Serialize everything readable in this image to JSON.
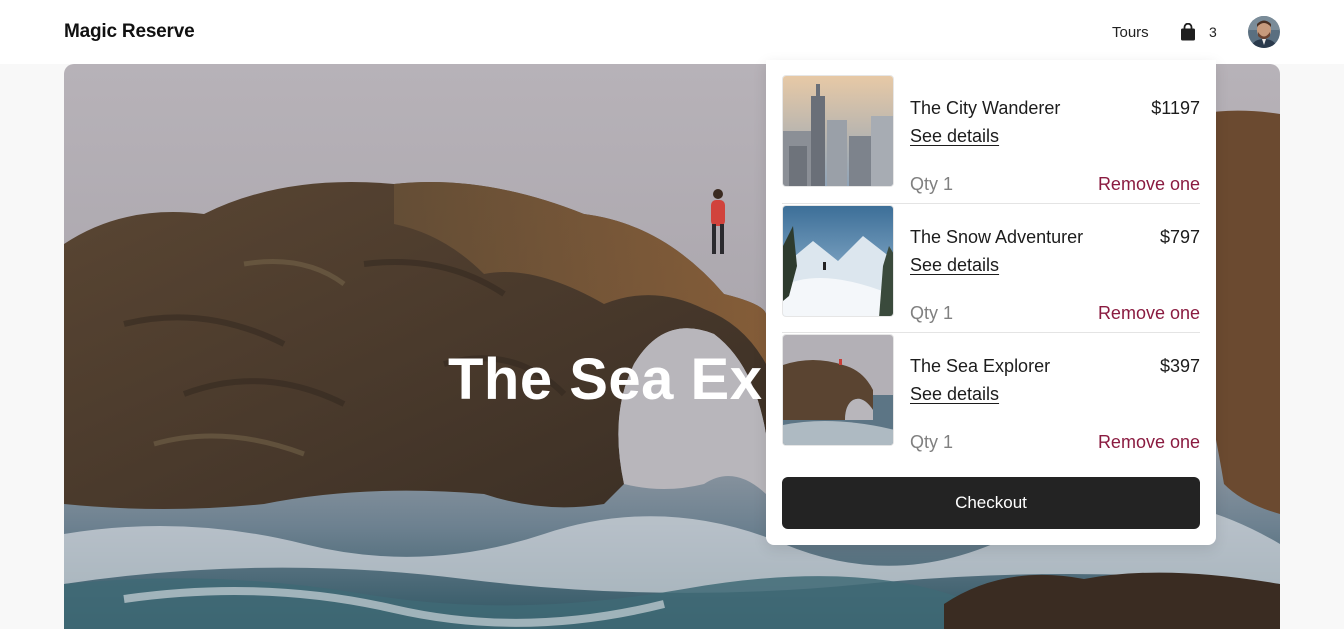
{
  "header": {
    "brand": "Magic Reserve",
    "nav_tours": "Tours",
    "cart_icon": "shopping-bag-icon",
    "cart_count": "3"
  },
  "hero": {
    "title": "The Sea Explorer"
  },
  "cart": {
    "items": [
      {
        "name": "The City Wanderer",
        "price": "$1197",
        "details_label": "See details",
        "qty": "Qty 1",
        "remove_label": "Remove one"
      },
      {
        "name": "The Snow Adventurer",
        "price": "$797",
        "details_label": "See details",
        "qty": "Qty 1",
        "remove_label": "Remove one"
      },
      {
        "name": "The Sea Explorer",
        "price": "$397",
        "details_label": "See details",
        "qty": "Qty 1",
        "remove_label": "Remove one"
      }
    ],
    "checkout_label": "Checkout"
  },
  "colors": {
    "remove_link": "#8a1b40",
    "checkout_bg": "#232323",
    "page_bg": "#f8f8f8"
  }
}
